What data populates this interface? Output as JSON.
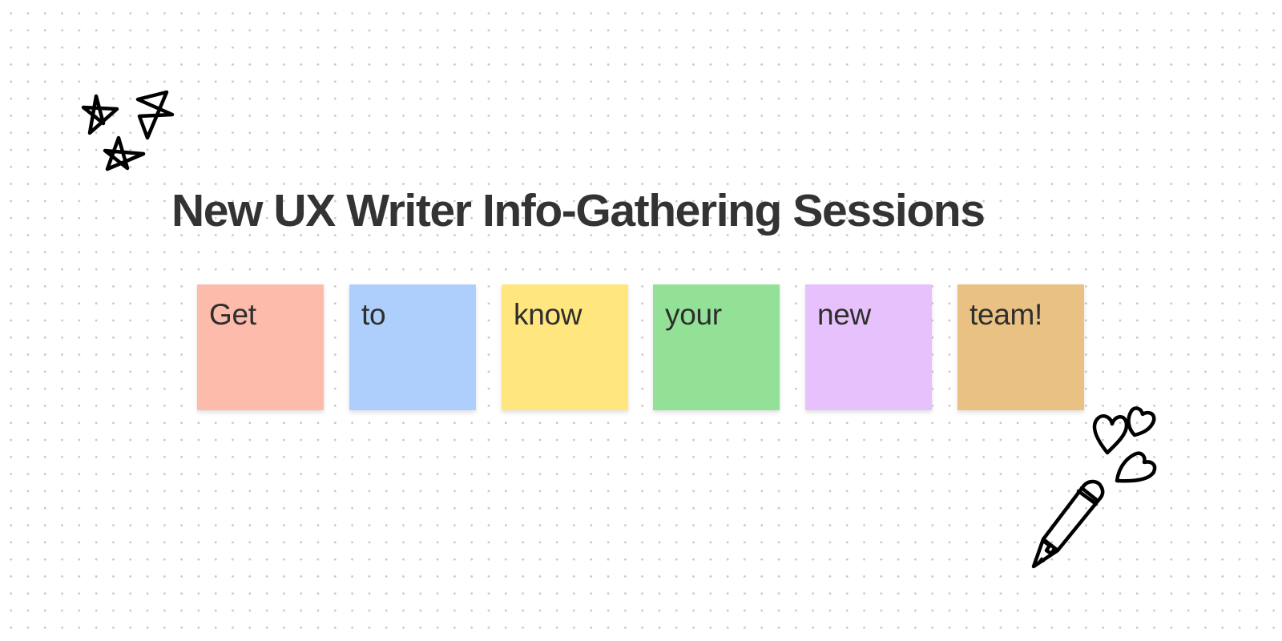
{
  "board": {
    "title": "New UX Writer Info-Gathering Sessions",
    "sticky_notes": [
      {
        "text": "Get",
        "color": "#FDBBAC"
      },
      {
        "text": "to",
        "color": "#AECFFC"
      },
      {
        "text": "know",
        "color": "#FFE67F"
      },
      {
        "text": "your",
        "color": "#93E196"
      },
      {
        "text": "new",
        "color": "#E7C1FC"
      },
      {
        "text": "team!",
        "color": "#E9C183"
      }
    ],
    "doodles": [
      "stars-doodle",
      "hearts-doodle",
      "pencil-doodle"
    ]
  }
}
